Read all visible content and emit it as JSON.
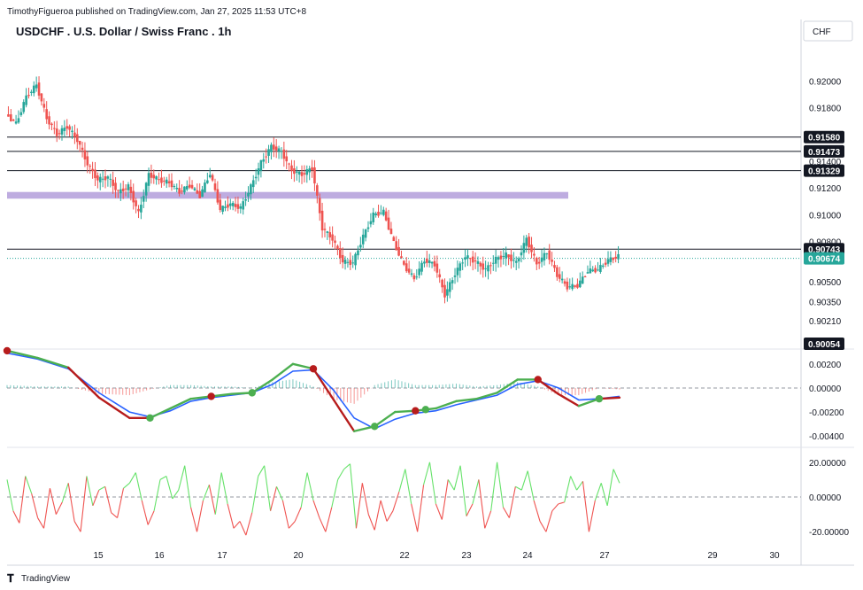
{
  "header": {
    "published_by": "TimothyFigueroa published on TradingView.com, Jan 27, 2025 11:53 UTC+8",
    "symbol_title": "USDCHF . U.S. Dollar / Swiss Franc . 1h",
    "currency_button": "CHF",
    "footer_logo": "TradingView"
  },
  "colors": {
    "up": "#26a69a",
    "down": "#ef5350",
    "zone": "#b39ddb",
    "macd_green": "#4caf50",
    "macd_red": "#b71c1c",
    "signal_blue": "#2962ff",
    "osc_green": "#66e26a",
    "osc_red": "#ef5350",
    "current_price_bg": "#26a69a"
  },
  "chart_data": [
    {
      "type": "candlestick",
      "pane": "price",
      "x_tick_labels": [
        "15",
        "16",
        "17",
        "20",
        "22",
        "23",
        "24",
        "27",
        "29",
        "30"
      ],
      "y_tick_labels": [
        "0.92000",
        "0.91800",
        "0.91400",
        "0.91200",
        "0.91000",
        "0.90800",
        "0.90500",
        "0.90350",
        "0.90210"
      ],
      "ylim": [
        0.9001,
        0.9224
      ],
      "horizontal_levels": [
        "0.91580",
        "0.91473",
        "0.91329",
        "0.90743"
      ],
      "current_price": "0.90674",
      "low_marker": "0.90054",
      "zone": [
        0.9112,
        0.9117
      ],
      "close_path": [
        [
          0,
          0.9175
        ],
        [
          1,
          0.9168
        ],
        [
          2,
          0.9188
        ],
        [
          3,
          0.9197
        ],
        [
          4,
          0.9172
        ],
        [
          5,
          0.916
        ],
        [
          6,
          0.9166
        ],
        [
          7,
          0.9156
        ],
        [
          8,
          0.9138
        ],
        [
          9,
          0.9126
        ],
        [
          10,
          0.9128
        ],
        [
          11,
          0.9117
        ],
        [
          12,
          0.9121
        ],
        [
          13,
          0.9101
        ],
        [
          14,
          0.913
        ],
        [
          15,
          0.9126
        ],
        [
          16,
          0.9124
        ],
        [
          17,
          0.9117
        ],
        [
          18,
          0.9122
        ],
        [
          19,
          0.9114
        ],
        [
          20,
          0.9131
        ],
        [
          21,
          0.9104
        ],
        [
          22,
          0.9108
        ],
        [
          23,
          0.9105
        ],
        [
          24,
          0.9121
        ],
        [
          25,
          0.9139
        ],
        [
          26,
          0.9151
        ],
        [
          27,
          0.9147
        ],
        [
          28,
          0.9133
        ],
        [
          29,
          0.913
        ],
        [
          30,
          0.9135
        ],
        [
          31,
          0.909
        ],
        [
          32,
          0.9082
        ],
        [
          33,
          0.9065
        ],
        [
          34,
          0.9064
        ],
        [
          35,
          0.9084
        ],
        [
          36,
          0.91
        ],
        [
          37,
          0.9102
        ],
        [
          38,
          0.9079
        ],
        [
          39,
          0.9062
        ],
        [
          40,
          0.9052
        ],
        [
          41,
          0.9066
        ],
        [
          42,
          0.9063
        ],
        [
          43,
          0.904
        ],
        [
          44,
          0.9056
        ],
        [
          45,
          0.9069
        ],
        [
          46,
          0.9065
        ],
        [
          47,
          0.9059
        ],
        [
          48,
          0.9067
        ],
        [
          49,
          0.907
        ],
        [
          50,
          0.9064
        ],
        [
          51,
          0.9082
        ],
        [
          52,
          0.9063
        ],
        [
          53,
          0.9072
        ],
        [
          54,
          0.9055
        ],
        [
          55,
          0.9046
        ],
        [
          56,
          0.9047
        ],
        [
          57,
          0.9058
        ],
        [
          58,
          0.9059
        ],
        [
          59,
          0.9066
        ],
        [
          60,
          0.9069
        ]
      ]
    },
    {
      "type": "line",
      "pane": "macd",
      "y_tick_labels": [
        "0.00200",
        "0.00000",
        "-0.00200",
        "-0.00400"
      ],
      "ylim": [
        -0.0048,
        0.0028
      ],
      "zero_line": 0.0,
      "series": [
        {
          "name": "MACD",
          "points": [
            [
              0,
              0.0031
            ],
            [
              3,
              0.0025
            ],
            [
              6,
              0.0017
            ],
            [
              9,
              -0.0008
            ],
            [
              12,
              -0.0025
            ],
            [
              14,
              -0.0025
            ],
            [
              16,
              -0.0017
            ],
            [
              18,
              -0.0009
            ],
            [
              20,
              -0.0007
            ],
            [
              22,
              -0.0005
            ],
            [
              24,
              -0.0004
            ],
            [
              26,
              0.0007
            ],
            [
              28,
              0.002
            ],
            [
              30,
              0.0016
            ],
            [
              32,
              -0.001
            ],
            [
              34,
              -0.0036
            ],
            [
              36,
              -0.0032
            ],
            [
              38,
              -0.002
            ],
            [
              40,
              -0.0019
            ],
            [
              42,
              -0.0017
            ],
            [
              44,
              -0.0011
            ],
            [
              46,
              -0.0009
            ],
            [
              48,
              -0.0004
            ],
            [
              50,
              0.0007
            ],
            [
              52,
              0.0007
            ],
            [
              54,
              -0.0005
            ],
            [
              56,
              -0.0015
            ],
            [
              58,
              -0.0009
            ],
            [
              60,
              -0.0008
            ]
          ]
        },
        {
          "name": "Signal",
          "points": [
            [
              0,
              0.0029
            ],
            [
              3,
              0.0024
            ],
            [
              6,
              0.0016
            ],
            [
              9,
              -0.0004
            ],
            [
              12,
              -0.002
            ],
            [
              14,
              -0.0024
            ],
            [
              16,
              -0.0019
            ],
            [
              18,
              -0.0011
            ],
            [
              20,
              -0.0008
            ],
            [
              22,
              -0.0006
            ],
            [
              24,
              -0.0004
            ],
            [
              26,
              0.0003
            ],
            [
              28,
              0.0014
            ],
            [
              30,
              0.0015
            ],
            [
              32,
              -0.0002
            ],
            [
              34,
              -0.0025
            ],
            [
              36,
              -0.0034
            ],
            [
              38,
              -0.0026
            ],
            [
              40,
              -0.0021
            ],
            [
              42,
              -0.0019
            ],
            [
              44,
              -0.0014
            ],
            [
              46,
              -0.001
            ],
            [
              48,
              -0.0006
            ],
            [
              50,
              0.0003
            ],
            [
              52,
              0.0006
            ],
            [
              54,
              0.0
            ],
            [
              56,
              -0.001
            ],
            [
              58,
              -0.0009
            ],
            [
              60,
              -0.0007
            ]
          ]
        }
      ],
      "cross_markers": [
        {
          "x": 0,
          "y": 0.0031,
          "kind": "bear"
        },
        {
          "x": 14,
          "y": -0.0025,
          "kind": "bull"
        },
        {
          "x": 20,
          "y": -0.0007,
          "kind": "bear"
        },
        {
          "x": 24,
          "y": -0.0004,
          "kind": "bull"
        },
        {
          "x": 30,
          "y": 0.0016,
          "kind": "bear"
        },
        {
          "x": 36,
          "y": -0.0032,
          "kind": "bull"
        },
        {
          "x": 40,
          "y": -0.0019,
          "kind": "bear"
        },
        {
          "x": 41,
          "y": -0.0018,
          "kind": "bull"
        },
        {
          "x": 52,
          "y": 0.0007,
          "kind": "bear"
        },
        {
          "x": 58,
          "y": -0.0009,
          "kind": "bull"
        }
      ]
    },
    {
      "type": "line",
      "pane": "oscillator",
      "y_tick_labels": [
        "20.00000",
        "0.00000",
        "-20.00000"
      ],
      "ylim": [
        -26,
        26
      ],
      "zero_line": 0.0,
      "values": [
        10,
        -8,
        -15,
        12,
        2,
        -12,
        -18,
        5,
        -10,
        -3,
        8,
        -14,
        -20,
        12,
        -5,
        4,
        6,
        -9,
        -12,
        5,
        8,
        14,
        -2,
        -16,
        -8,
        10,
        12,
        -1,
        4,
        18,
        -6,
        -20,
        -2,
        7,
        -10,
        14,
        -4,
        -18,
        -14,
        -22,
        -9,
        12,
        18,
        -8,
        6,
        -2,
        -18,
        -14,
        -6,
        14,
        -2,
        -12,
        -20,
        -6,
        10,
        16,
        19,
        -18,
        8,
        -10,
        -19,
        -2,
        -14,
        -8,
        3,
        16,
        -4,
        -20,
        7,
        20,
        -4,
        -13,
        10,
        4,
        18,
        -11,
        -4,
        10,
        -18,
        -8,
        20,
        -6,
        -12,
        6,
        4,
        15,
        -2,
        -14,
        -20,
        -8,
        -4,
        -3,
        12,
        4,
        9,
        -20,
        -2,
        8,
        -5,
        16,
        8
      ]
    }
  ]
}
